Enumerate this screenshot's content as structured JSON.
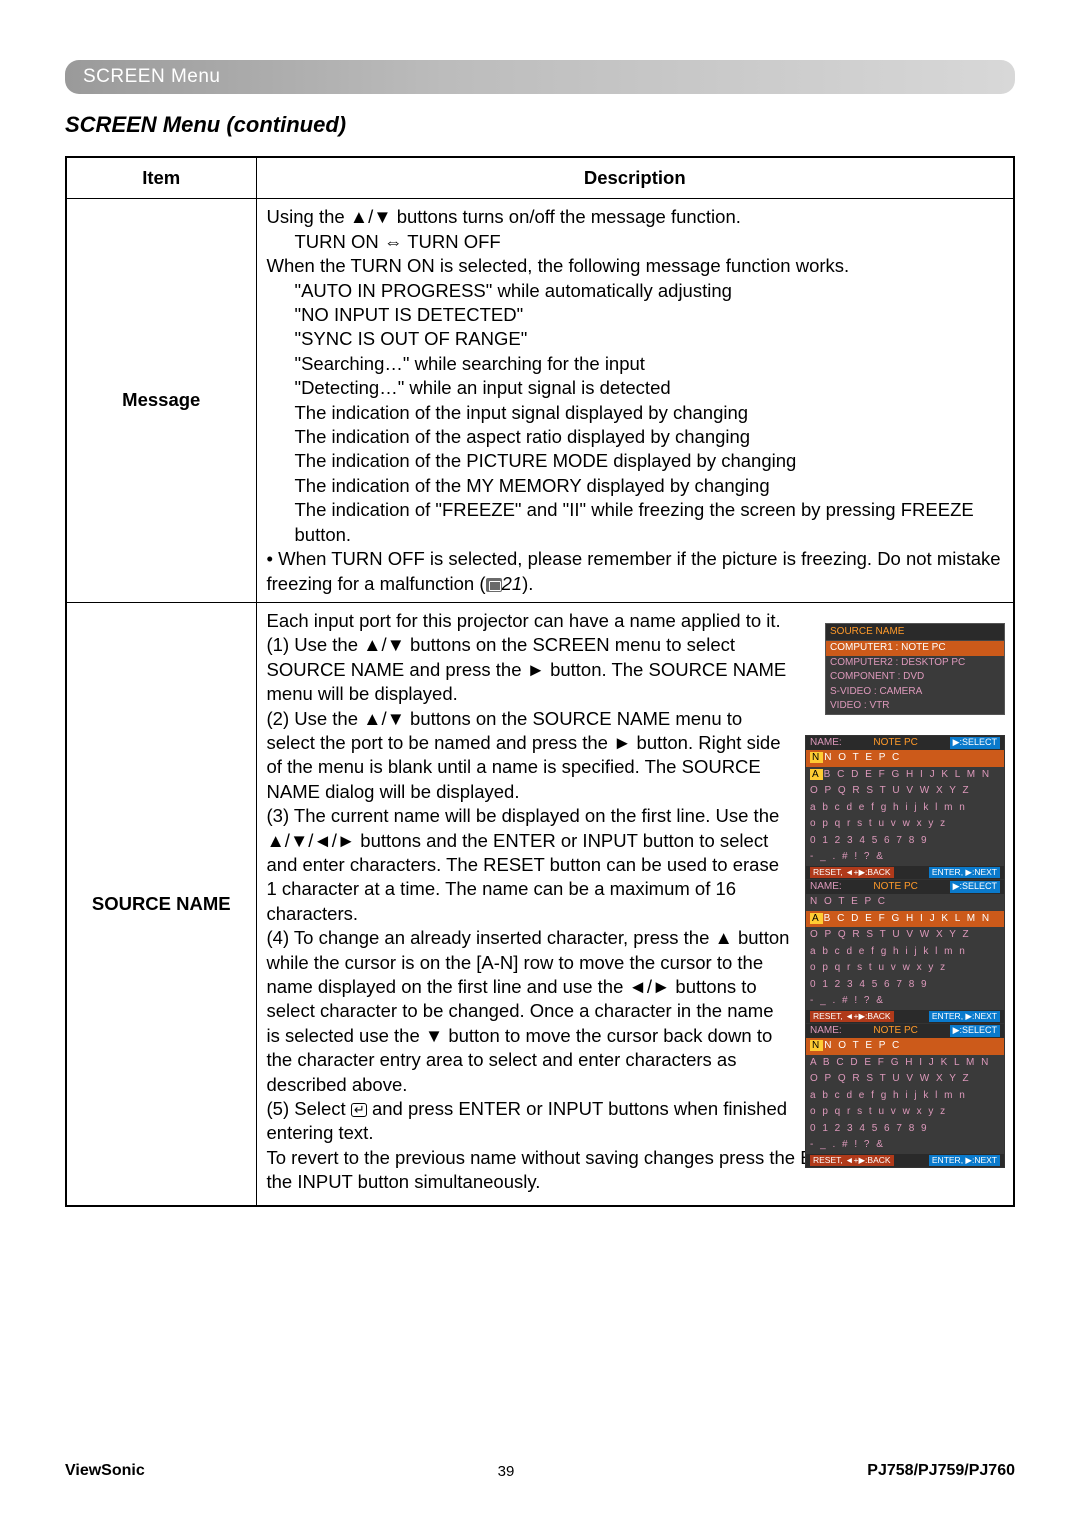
{
  "header": {
    "bar": "SCREEN Menu",
    "title": "SCREEN Menu (continued)"
  },
  "table": {
    "headers": {
      "item": "Item",
      "description": "Description"
    },
    "row_message": {
      "item": "Message",
      "line1_a": "Using the ",
      "line1_b": " buttons turns on/off the message function.",
      "turn_toggle": "TURN ON ⇔ TURN OFF",
      "when_on": "When the TURN ON is selected, the following message function works.",
      "msgs": [
        "\"AUTO IN PROGRESS\" while automatically adjusting",
        "\"NO INPUT IS DETECTED\"",
        "\"SYNC IS OUT OF RANGE\"",
        "\"Searching…\" while searching for the input",
        "\"Detecting…\" while an input signal is detected",
        "The indication of the input signal displayed by changing",
        "The indication of the aspect ratio displayed by changing",
        "The indication of the PICTURE MODE displayed by changing",
        "The indication of the MY MEMORY displayed by changing",
        "The indication of \"FREEZE\" and \"II\" while freezing the screen by pressing FREEZE button."
      ],
      "bullet_off_a": "• When TURN OFF is selected, please remember if the picture is freezing. Do not mistake freezing for a malfunction (",
      "bullet_off_ref": "21",
      "bullet_off_b": ")."
    },
    "row_source": {
      "item": "SOURCE NAME",
      "intro": "Each input port for this projector can have a name applied to it.",
      "step1_a": "(1) Use the ",
      "step1_b": " buttons on the SCREEN menu to select SOURCE NAME and press the ",
      "step1_c": " button. The SOURCE NAME menu will be displayed.",
      "step2_a": "(2) Use the ",
      "step2_b": " buttons on the SOURCE NAME menu to select the port to be named and press the ",
      "step2_c": " button. Right side of the menu is blank until a name is specified. The SOURCE NAME dialog will be displayed.",
      "step3_a": "(3) The current name will be displayed on the first line. Use the ",
      "step3_b": " buttons and the ENTER or INPUT button to select and enter characters. The RESET button can be used to erase 1 character at a time. The name can be a maximum of 16 characters.",
      "step4_a": "(4) To change an already inserted character, press the ",
      "step4_b": " button while the cursor is on the [A-N] row to move the cursor to the name displayed on the first line and use the ",
      "step4_c": " buttons to select character to be changed. Once a character in the name is selected use the ",
      "step4_d": " button to move the cursor back down to the character entry area to select and enter characters as described above.",
      "step5_a": "(5) Select ",
      "step5_b": " and press ENTER or INPUT buttons when finished entering text.",
      "revert": "To revert to the previous name without saving changes press the ESC or ◄ button and the INPUT button simultaneously."
    }
  },
  "osd": {
    "src_title": "SOURCE NAME",
    "src_rows": [
      "COMPUTER1 : NOTE PC",
      "COMPUTER2 : DESKTOP PC",
      "COMPONENT : DVD",
      "S-VIDEO : CAMERA",
      "VIDEO : VTR"
    ],
    "name_label": "NAME:",
    "name_value": "NOTE PC",
    "select_tag": "▶:SELECT",
    "rows_upper": "B C D E F G H I J K L M N",
    "rows_o": "O P Q R S T U V W X Y Z",
    "rows_lower1": "a b c d e f g h i j k l m n",
    "rows_lower2": "o p q r s t u v w x y z",
    "rows_num": "0 1 2 3 4 5 6 7 8 9",
    "rows_sym": "- _ . # ! ? &",
    "entered1": "N O T E   P C",
    "cur_a": "A",
    "cur_n": "N",
    "reset": "RESET, ◄+▶:BACK",
    "enter": "ENTER, ▶:NEXT"
  },
  "footer": {
    "brand": "ViewSonic",
    "page": "39",
    "model": "PJ758/PJ759/PJ760"
  },
  "symbols": {
    "updown": "▲/▼",
    "right": "►",
    "up": "▲",
    "down": "▼",
    "all4": "▲/▼/◄/►",
    "leftright": "◄/►"
  }
}
